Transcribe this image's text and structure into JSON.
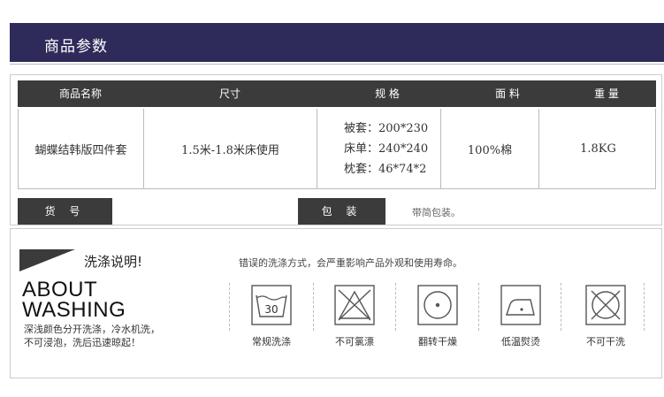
{
  "header": {
    "title": "商品参数"
  },
  "table": {
    "headers": [
      "商品名称",
      "尺寸",
      "规 格",
      "面 料",
      "重 量"
    ],
    "row": {
      "name": "蝴蝶结韩版四件套",
      "size": "1.5米-1.8米床使用",
      "specs": [
        "被套：200*230",
        "床单：240*240",
        "枕套：46*74*2"
      ],
      "fabric": "100%棉",
      "weight": "1.8KG"
    }
  },
  "labels": {
    "item_no": "货 号",
    "packaging": "包 装",
    "packaging_value": "带简包装。"
  },
  "washing": {
    "title": "洗涤说明!",
    "warning": "错误的洗涤方式，会严重影响产品外观和使用寿命。",
    "heading_line1": "ABOUT",
    "heading_line2": "WASHING",
    "note_line1": "深浅颜色分开洗涤，冷水机洗，",
    "note_line2": "不可浸泡，洗后迅速晾起！",
    "tub_temperature": "30",
    "icons": [
      {
        "icon": "wash-30-icon",
        "label": "常规洗涤"
      },
      {
        "icon": "no-bleach-icon",
        "label": "不可氯漂"
      },
      {
        "icon": "tumble-dry-icon",
        "label": "翻转干燥"
      },
      {
        "icon": "iron-low-icon",
        "label": "低温熨烫"
      },
      {
        "icon": "no-dry-clean-icon",
        "label": "不可干洗"
      }
    ]
  },
  "colors": {
    "header_bg": "#2e2a5a",
    "dark_bar": "#3b3b3b",
    "border": "#cccccc"
  }
}
